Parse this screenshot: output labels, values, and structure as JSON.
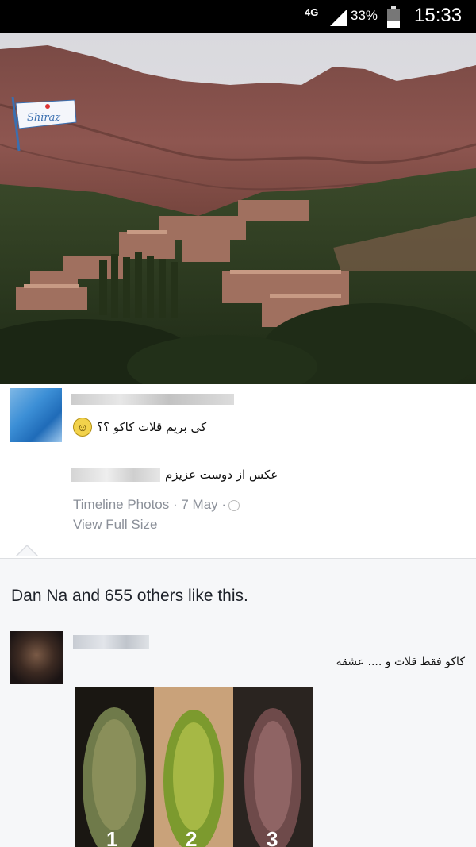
{
  "status_bar": {
    "network": "4G",
    "battery": "33%",
    "time": "15:33"
  },
  "hero": {
    "logo_text": "Shiraz"
  },
  "post": {
    "status_text": "کی بریم قلات کاکو ؟؟",
    "caption": "عکس از دوست عزیزم",
    "meta": "Timeline Photos · 7 May ·",
    "view_full": "View Full Size"
  },
  "likes": {
    "text": "Dan Na and 655 others like this."
  },
  "comment": {
    "text": "کاکو فقط قلات و .... عشقه",
    "labels": [
      "1",
      "2",
      "3"
    ]
  }
}
